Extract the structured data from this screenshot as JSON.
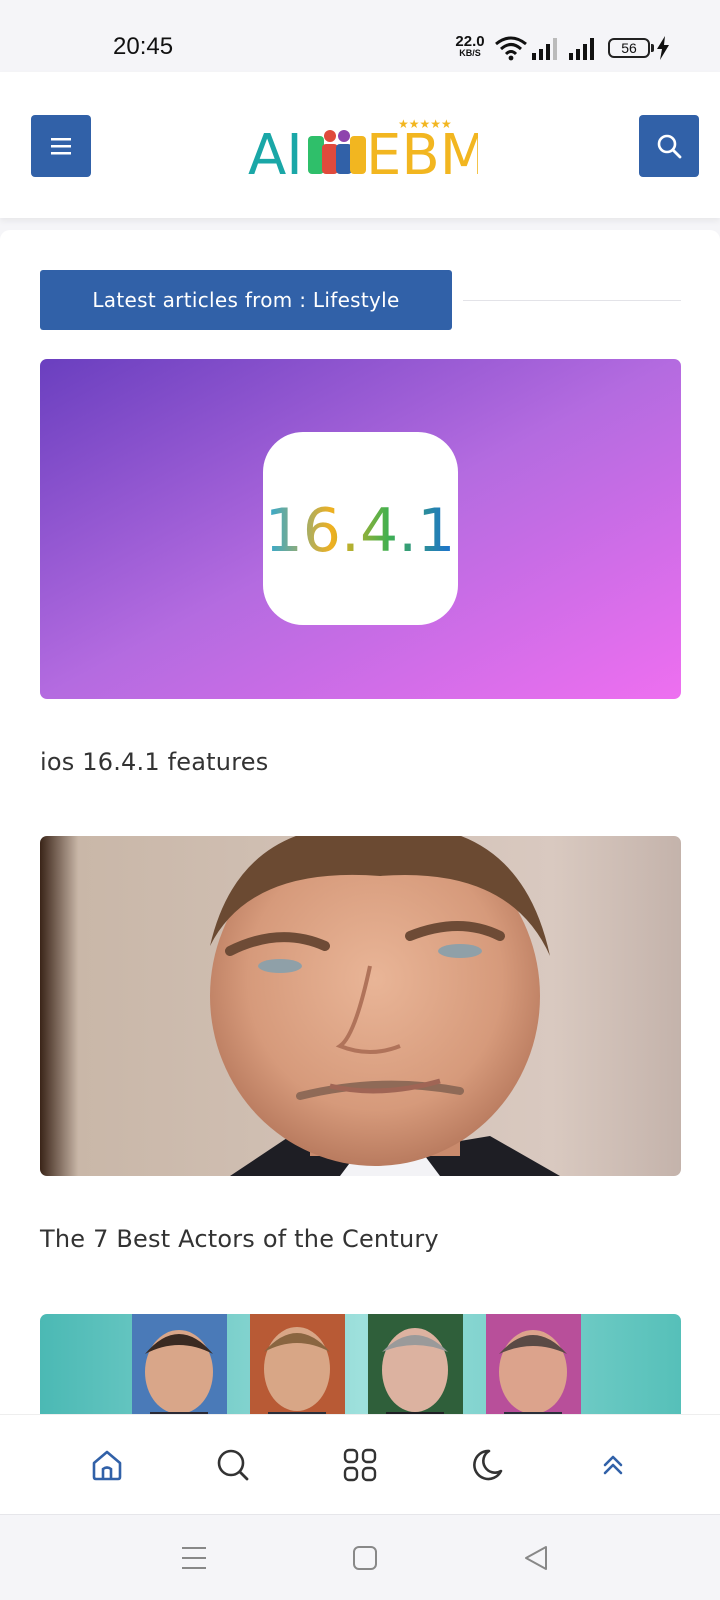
{
  "status": {
    "time": "20:45",
    "net_speed": "22.0",
    "net_unit": "KB/S",
    "battery": "56"
  },
  "header": {
    "logo_text": "AIWEBM"
  },
  "section": {
    "title": "Latest articles from : Lifestyle"
  },
  "articles": [
    {
      "title": "ios 16.4.1 features",
      "badge": "16.4.1"
    },
    {
      "title": "The 7 Best Actors of the Century"
    },
    {
      "title": ""
    }
  ],
  "colors": {
    "accent": "#3161a8",
    "nav_active": "#3161a8"
  },
  "bottom_nav": [
    "home-icon",
    "search-icon",
    "grid-icon",
    "moon-icon",
    "scroll-top-icon"
  ],
  "system_nav": [
    "recents-icon",
    "home-square-icon",
    "back-icon"
  ]
}
